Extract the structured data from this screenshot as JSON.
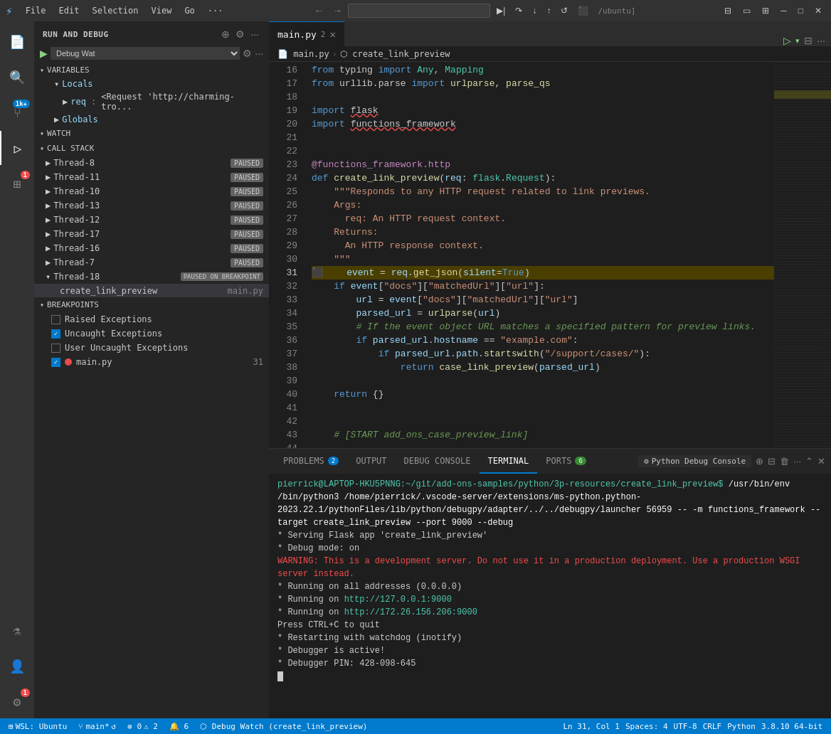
{
  "titlebar": {
    "icon": "⚡",
    "menus": [
      "File",
      "Edit",
      "Selection",
      "View",
      "Go",
      "···"
    ],
    "search_placeholder": "",
    "nav_back": "←",
    "nav_forward": "→",
    "debug_controls": [
      "▶|",
      "▶",
      "⏸",
      "↩",
      "↪",
      "↺",
      "⬛"
    ],
    "debug_path": "/ubuntu]",
    "window_controls": [
      "─",
      "□",
      "✕"
    ]
  },
  "activity_bar": {
    "items": [
      {
        "name": "explorer",
        "icon": "⎗",
        "active": false
      },
      {
        "name": "search",
        "icon": "🔍",
        "active": false
      },
      {
        "name": "source-control",
        "icon": "⑂",
        "active": false,
        "badge": "1k+"
      },
      {
        "name": "run-debug",
        "icon": "▷",
        "active": true
      },
      {
        "name": "extensions",
        "icon": "⊞",
        "active": false,
        "badge": "1"
      },
      {
        "name": "testing",
        "icon": "⚗",
        "active": false
      },
      {
        "name": "remote",
        "icon": "⛭",
        "active": false
      }
    ]
  },
  "sidebar": {
    "title": "RUN AND DEBUG",
    "debug_config": "Debug Wat",
    "sections": {
      "variables": {
        "label": "VARIABLES",
        "locals": {
          "label": "Locals",
          "items": [
            {
              "name": "req",
              "value": "<Request 'http://charming-tro..."
            }
          ]
        },
        "globals": {
          "label": "Globals"
        }
      },
      "watch": {
        "label": "WATCH"
      },
      "callstack": {
        "label": "CALL STACK",
        "threads": [
          {
            "name": "Thread-8",
            "status": "PAUSED"
          },
          {
            "name": "Thread-11",
            "status": "PAUSED"
          },
          {
            "name": "Thread-10",
            "status": "PAUSED"
          },
          {
            "name": "Thread-13",
            "status": "PAUSED"
          },
          {
            "name": "Thread-12",
            "status": "PAUSED"
          },
          {
            "name": "Thread-17",
            "status": "PAUSED"
          },
          {
            "name": "Thread-16",
            "status": "PAUSED"
          },
          {
            "name": "Thread-7",
            "status": "PAUSED"
          },
          {
            "name": "Thread-18",
            "status": "PAUSED ON BREAKPOINT",
            "frame": {
              "fn": "create_link_preview",
              "file": "main.py"
            }
          }
        ]
      },
      "breakpoints": {
        "label": "BREAKPOINTS",
        "items": [
          {
            "label": "Raised Exceptions",
            "checked": false
          },
          {
            "label": "Uncaught Exceptions",
            "checked": true
          },
          {
            "label": "User Uncaught Exceptions",
            "checked": false
          },
          {
            "label": "main.py",
            "checked": true,
            "line": "31",
            "has_dot": true
          }
        ]
      }
    }
  },
  "editor": {
    "tabs": [
      {
        "label": "main.py",
        "number": "2",
        "active": true,
        "modified": false
      }
    ],
    "breadcrumb": [
      "main.py",
      "create_link_preview"
    ],
    "current_line": 31,
    "lines": [
      {
        "n": 16,
        "code": "<span class='kw'>from</span> typing <span class='kw'>import</span> <span class='tp'>Any</span>, <span class='tp'>Mapping</span>"
      },
      {
        "n": 17,
        "code": "<span class='kw'>from</span> urllib.parse <span class='kw'>import</span> <span class='fn'>urlparse</span>, <span class='fn'>parse_qs</span>"
      },
      {
        "n": 18,
        "code": ""
      },
      {
        "n": 19,
        "code": "<span class='kw'>import</span> <span style='text-decoration:underline wavy #f14c4c'>flask</span>"
      },
      {
        "n": 20,
        "code": "<span class='kw'>import</span> <span style='text-decoration:underline wavy #f14c4c'>functions_framework</span>"
      },
      {
        "n": 21,
        "code": ""
      },
      {
        "n": 22,
        "code": ""
      },
      {
        "n": 23,
        "code": "<span class='dec'>@functions_framework</span><span class='dec'>.http</span>"
      },
      {
        "n": 24,
        "code": "<span class='kw'>def</span> <span class='fn'>create_link_preview</span>(<span class='param'>req</span>: <span class='tp'>flask</span>.<span class='tp'>Request</span>):"
      },
      {
        "n": 25,
        "code": "    <span class='str'>\"\"\"Responds to any HTTP request related to link previews.</span>"
      },
      {
        "n": 26,
        "code": "    <span class='str'>Args:</span>"
      },
      {
        "n": 27,
        "code": "      <span class='str'>req: An HTTP request context.</span>"
      },
      {
        "n": 28,
        "code": "    <span class='str'>Returns:</span>"
      },
      {
        "n": 29,
        "code": "      <span class='str'>An HTTP response context.</span>"
      },
      {
        "n": 30,
        "code": "    <span class='str'>\"\"\"</span>"
      },
      {
        "n": 31,
        "code": "    <span class='param'>event</span> = <span class='param'>req</span>.<span class='fn'>get_json</span>(<span class='param'>silent</span>=<span class='kw'>True</span>)",
        "current": true
      },
      {
        "n": 32,
        "code": "    <span class='kw'>if</span> <span class='param'>event</span>[<span class='str'>\"docs\"</span>][<span class='str'>\"matchedUrl\"</span>][<span class='str'>\"url\"</span>]:"
      },
      {
        "n": 33,
        "code": "        <span class='param'>url</span> = <span class='param'>event</span>[<span class='str'>\"docs\"</span>][<span class='str'>\"matchedUrl\"</span>][<span class='str'>\"url\"</span>]"
      },
      {
        "n": 34,
        "code": "        <span class='param'>parsed_url</span> = <span class='fn'>urlparse</span>(<span class='param'>url</span>)"
      },
      {
        "n": 35,
        "code": "        <span class='cm'># If the event object URL matches a specified pattern for preview links.</span>"
      },
      {
        "n": 36,
        "code": "        <span class='kw'>if</span> <span class='param'>parsed_url</span>.<span class='param'>hostname</span> == <span class='str'>\"example.com\"</span>:"
      },
      {
        "n": 37,
        "code": "            <span class='kw'>if</span> <span class='param'>parsed_url</span>.<span class='param'>path</span>.<span class='fn'>startswith</span>(<span class='str'>\"/support/cases/\"</span>):"
      },
      {
        "n": 38,
        "code": "                <span class='kw'>return</span> <span class='fn'>case_link_preview</span>(<span class='param'>parsed_url</span>)"
      },
      {
        "n": 39,
        "code": ""
      },
      {
        "n": 40,
        "code": "    <span class='kw'>return</span> {}"
      },
      {
        "n": 41,
        "code": ""
      },
      {
        "n": 42,
        "code": ""
      },
      {
        "n": 43,
        "code": "    <span class='cm'># [START add_ons_case_preview_link]</span>"
      },
      {
        "n": 44,
        "code": ""
      }
    ]
  },
  "panel": {
    "tabs": [
      {
        "label": "PROBLEMS",
        "badge": "2",
        "active": false
      },
      {
        "label": "OUTPUT",
        "active": false
      },
      {
        "label": "DEBUG CONSOLE",
        "active": false
      },
      {
        "label": "TERMINAL",
        "active": true
      },
      {
        "label": "PORTS",
        "badge": "6",
        "active": false
      }
    ],
    "python_debug_console": "Python Debug Console",
    "terminal": {
      "prompt": "pierrick@LAPTOP-HKU5PNNG:~/git/add-ons-samples/python/3p-resources/create_link_preview$",
      "command": " /usr/bin/env /bin/python3 /home/pierrick/.vscode-server/extensions/ms-python.python-2023.22.1/pythonFiles/lib/python/debugpy/adapter/../../debugpy/launcher 56959 -- -m functions_framework --target create_link_preview --port 9000 --debug",
      "output": [
        " * Serving Flask app 'create_link_preview'",
        " * Debug mode: on",
        "WARNING: This is a development server. Do not use it in a production deployment. Use a production WSGI server instead.",
        " * Running on all addresses (0.0.0.0)",
        " * Running on http://127.0.0.1:9000",
        " * Running on http://172.26.156.206:9000",
        "Press CTRL+C to quit",
        " * Restarting with watchdog (inotify)",
        " * Debugger is active!",
        " * Debugger PIN: 428-098-645"
      ]
    }
  },
  "statusbar": {
    "wsl": "WSL: Ubuntu",
    "branch": "main*",
    "sync": "↺",
    "errors": "⊗ 0",
    "warnings": "⚠ 2",
    "notifs": "🔔 6",
    "debug_info": "⬡ Debug Watch (create_link_preview)",
    "line_col": "Ln 31, Col 1",
    "spaces": "Spaces: 4",
    "encoding": "UTF-8",
    "line_ending": "CRLF",
    "language": "Python",
    "version": "3.8.10 64-bit"
  }
}
